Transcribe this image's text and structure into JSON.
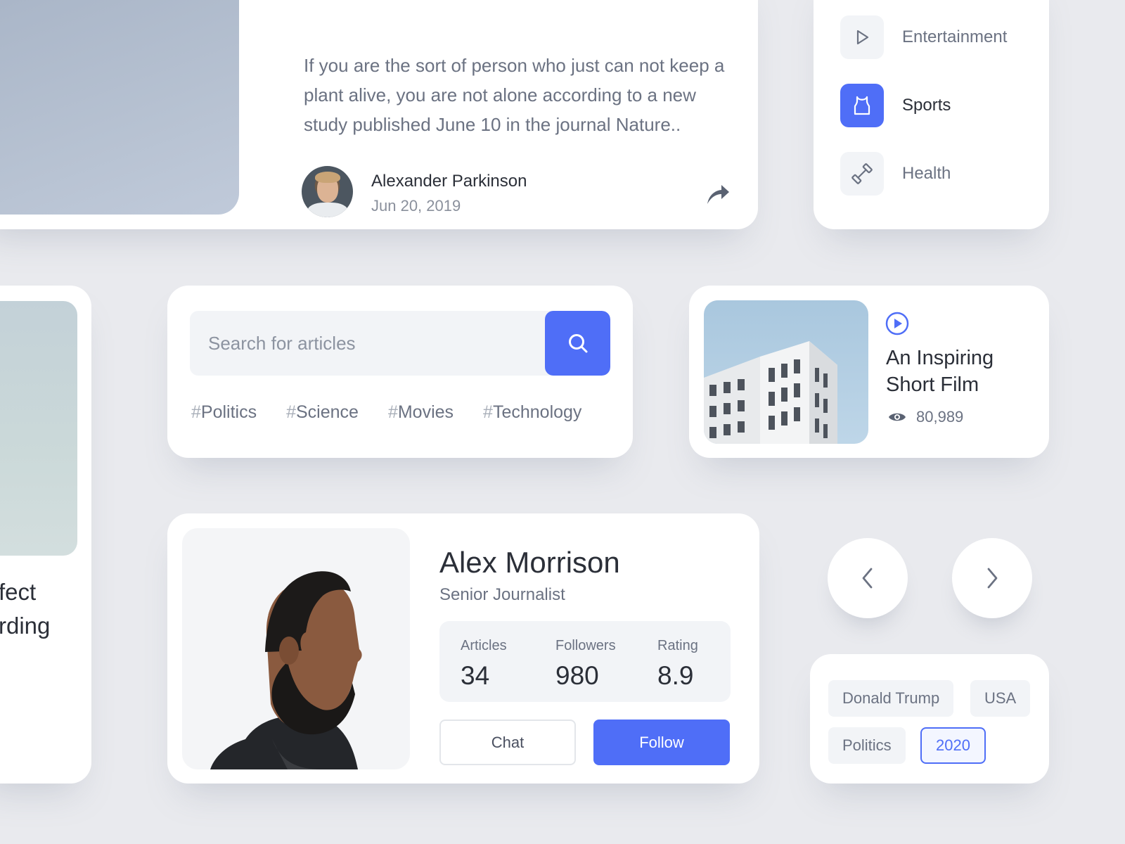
{
  "article": {
    "text": "If you are the sort of person who just can not keep a plant alive, you are not alone according to a new study published June 10 in the journal Nature..",
    "author_name": "Alexander Parkinson",
    "date": "Jun 20, 2019",
    "share_icon": "share-arrow-icon"
  },
  "categories": [
    {
      "label": "Entertainment",
      "icon": "play-icon",
      "active": false
    },
    {
      "label": "Sports",
      "icon": "jersey-icon",
      "active": true
    },
    {
      "label": "Health",
      "icon": "dumbbell-icon",
      "active": false
    }
  ],
  "left_card": {
    "line1": "fect",
    "line2": "rding"
  },
  "search": {
    "placeholder": "Search for articles",
    "tags": [
      "Politics",
      "Science",
      "Movies",
      "Technology"
    ],
    "tag_prefix": "#"
  },
  "video": {
    "title": "An Inspiring Short Film",
    "views": "80,989"
  },
  "profile": {
    "name": "Alex Morrison",
    "role": "Senior Journalist",
    "stats": [
      {
        "label": "Articles",
        "value": "34"
      },
      {
        "label": "Followers",
        "value": "980"
      },
      {
        "label": "Rating",
        "value": "8.9"
      }
    ],
    "chat_label": "Chat",
    "follow_label": "Follow"
  },
  "topics": [
    "Donald Trump",
    "USA",
    "Politics",
    "2020"
  ],
  "colors": {
    "accent": "#4f6ef7",
    "background": "#e9eaee",
    "card": "#ffffff",
    "muted_text": "#6b7282"
  }
}
